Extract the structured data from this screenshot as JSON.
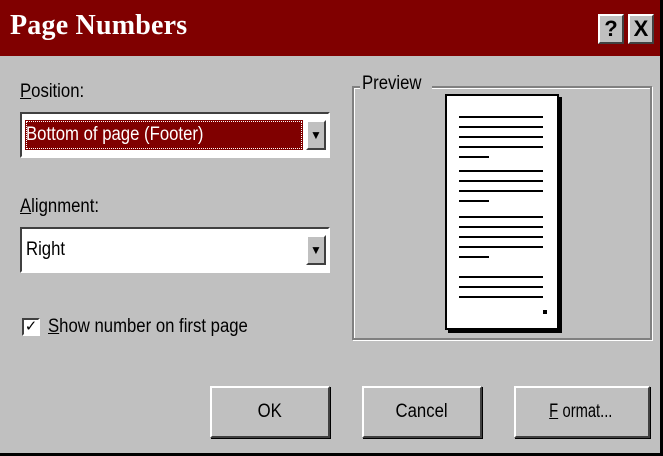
{
  "dialog": {
    "title": "Page Numbers",
    "help_glyph": "?",
    "close_glyph": "X",
    "title_bar_color": "#800000",
    "face_color": "#c0c0c0"
  },
  "position": {
    "label_mnemonic": "P",
    "label_rest": "osition:",
    "value": "Bottom of page (Footer)",
    "focused": true
  },
  "alignment": {
    "label_mnemonic": "A",
    "label_rest": "lignment:",
    "value": "Right"
  },
  "show_first": {
    "checked": true,
    "check_glyph": "✓",
    "label_mnemonic": "S",
    "label_rest": "how number on first page"
  },
  "preview": {
    "title": "Preview"
  },
  "buttons": {
    "ok": "OK",
    "cancel": "Cancel",
    "format_mnemonic": "F",
    "format_rest": "ormat..."
  },
  "icons": {
    "dropdown": "chevron-down-icon",
    "check": "checkmark-icon"
  }
}
